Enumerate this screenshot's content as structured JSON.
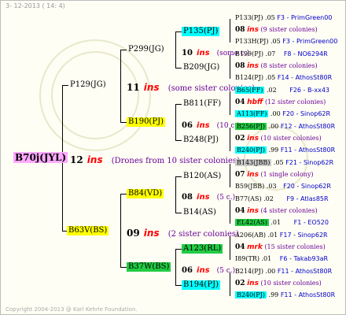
{
  "header": {
    "date_text": "3- 12-2013 ( 14: 4)"
  },
  "footer": {
    "copyright": "Copyright 2004-2013 @ Karl Kehrle Foundation."
  },
  "root": {
    "label": "B70j(JYL)",
    "count": "12",
    "ins": "ins",
    "note": "(Drones from 10 sister colonies)"
  },
  "g1": {
    "top": {
      "label": "P129(JG)",
      "count": "11",
      "ins": "ins",
      "note": "(some sister colonies)"
    },
    "bottom": {
      "label": "B63V(BS)",
      "count": "09",
      "ins": "ins",
      "note": "(2 sister colonies)"
    }
  },
  "g2": {
    "a": {
      "label": "P299(JG)",
      "count": "10",
      "ins": "ins",
      "note": "(some c.)"
    },
    "b": {
      "label": "B190(PJ)",
      "count": "06",
      "ins": "ins",
      "note": "(10 c.)"
    },
    "c": {
      "label": "B84(VD)",
      "count": "08",
      "ins": "ins",
      "note": "(5 c.)"
    },
    "d": {
      "label": "B37W(BS)",
      "count": "06",
      "ins": "ins",
      "note": "(5 c.)"
    }
  },
  "g3": {
    "a1": {
      "label": "P135(PJ)"
    },
    "a2": {
      "label": "B209(JG)"
    },
    "b1": {
      "label": "B811(FF)"
    },
    "b2": {
      "label": "B248(PJ)"
    },
    "c1": {
      "label": "B120(AS)"
    },
    "c2": {
      "label": "B14(AS)"
    },
    "d1": {
      "label": "A123(RL)"
    },
    "d2": {
      "label": "B194(PJ)"
    }
  },
  "leaves": {
    "a1_top": {
      "label": "P133(PJ)",
      "score": ".05",
      "src": "F3 - PrimGreen00"
    },
    "a1_mid": {
      "count": "08",
      "ins": "ins",
      "note": "(9 sister colonies)"
    },
    "a1_bot": {
      "label": "P133H(PJ)",
      "score": ".05",
      "src": "F3 - PrimGreen00"
    },
    "a2_top": {
      "label": "B199(PJ)",
      "score": ".07",
      "src": "F8 - NO6294R"
    },
    "a2_mid": {
      "count": "08",
      "ins": "ins",
      "note": "(8 sister colonies)"
    },
    "a2_bot": {
      "label": "B124(PJ)",
      "score": ".05",
      "src": "F14 - AthosSt80R"
    },
    "b1_top": {
      "label": "B65(FF)",
      "score": ".02",
      "src": "F26 - B-xx43"
    },
    "b1_mid": {
      "count": "04",
      "ins": "hbff",
      "note": "(12 sister colonies)"
    },
    "b1_bot": {
      "label": "A113(FF)",
      "score": ".00",
      "src": "F20 - Sinop62R"
    },
    "b2_top": {
      "label": "B256(PJ)",
      "score": ".00",
      "src": "F12 - AthosSt80R"
    },
    "b2_mid": {
      "count": "02",
      "ins": "ins",
      "note": "(10 sister colonies)"
    },
    "b2_bot": {
      "label": "B240(PJ)",
      "score": ".99",
      "src": "F11 - AthosSt80R"
    },
    "c1_top": {
      "label": "B143(JBB)",
      "score": ".05",
      "src": "F21 - Sinop62R"
    },
    "c1_mid": {
      "count": "07",
      "ins": "ins",
      "note": "(1 single colony)"
    },
    "c1_bot": {
      "label": "B59(JBB)",
      "score": ".03",
      "src": "F20 - Sinop62R"
    },
    "c2_top": {
      "label": "B77(AS)",
      "score": ".02",
      "src": "F9 - Atlas85R"
    },
    "c2_mid": {
      "count": "04",
      "ins": "ins",
      "note": "(4 sister colonies)"
    },
    "c2_bot": {
      "label": "EL42(AS)",
      "score": ".01",
      "src": "F1 - EO520"
    },
    "d1_top": {
      "label": "A206(AB)",
      "score": ".01",
      "src": "F17 - Sinop62R"
    },
    "d1_mid": {
      "count": "04",
      "ins": "mrk",
      "note": "(15 sister colonies)"
    },
    "d1_bot": {
      "label": "I89(TR)",
      "score": ".01",
      "src": "F6 - Takab93aR"
    },
    "d2_top": {
      "label": "B214(PJ)",
      "score": ".00",
      "src": "F11 - AthosSt80R"
    },
    "d2_mid": {
      "count": "02",
      "ins": "ins",
      "note": "(10 sister colonies)"
    },
    "d2_bot": {
      "label": "B240(PJ)",
      "score": ".99",
      "src": "F11 - AthosSt80R"
    }
  }
}
